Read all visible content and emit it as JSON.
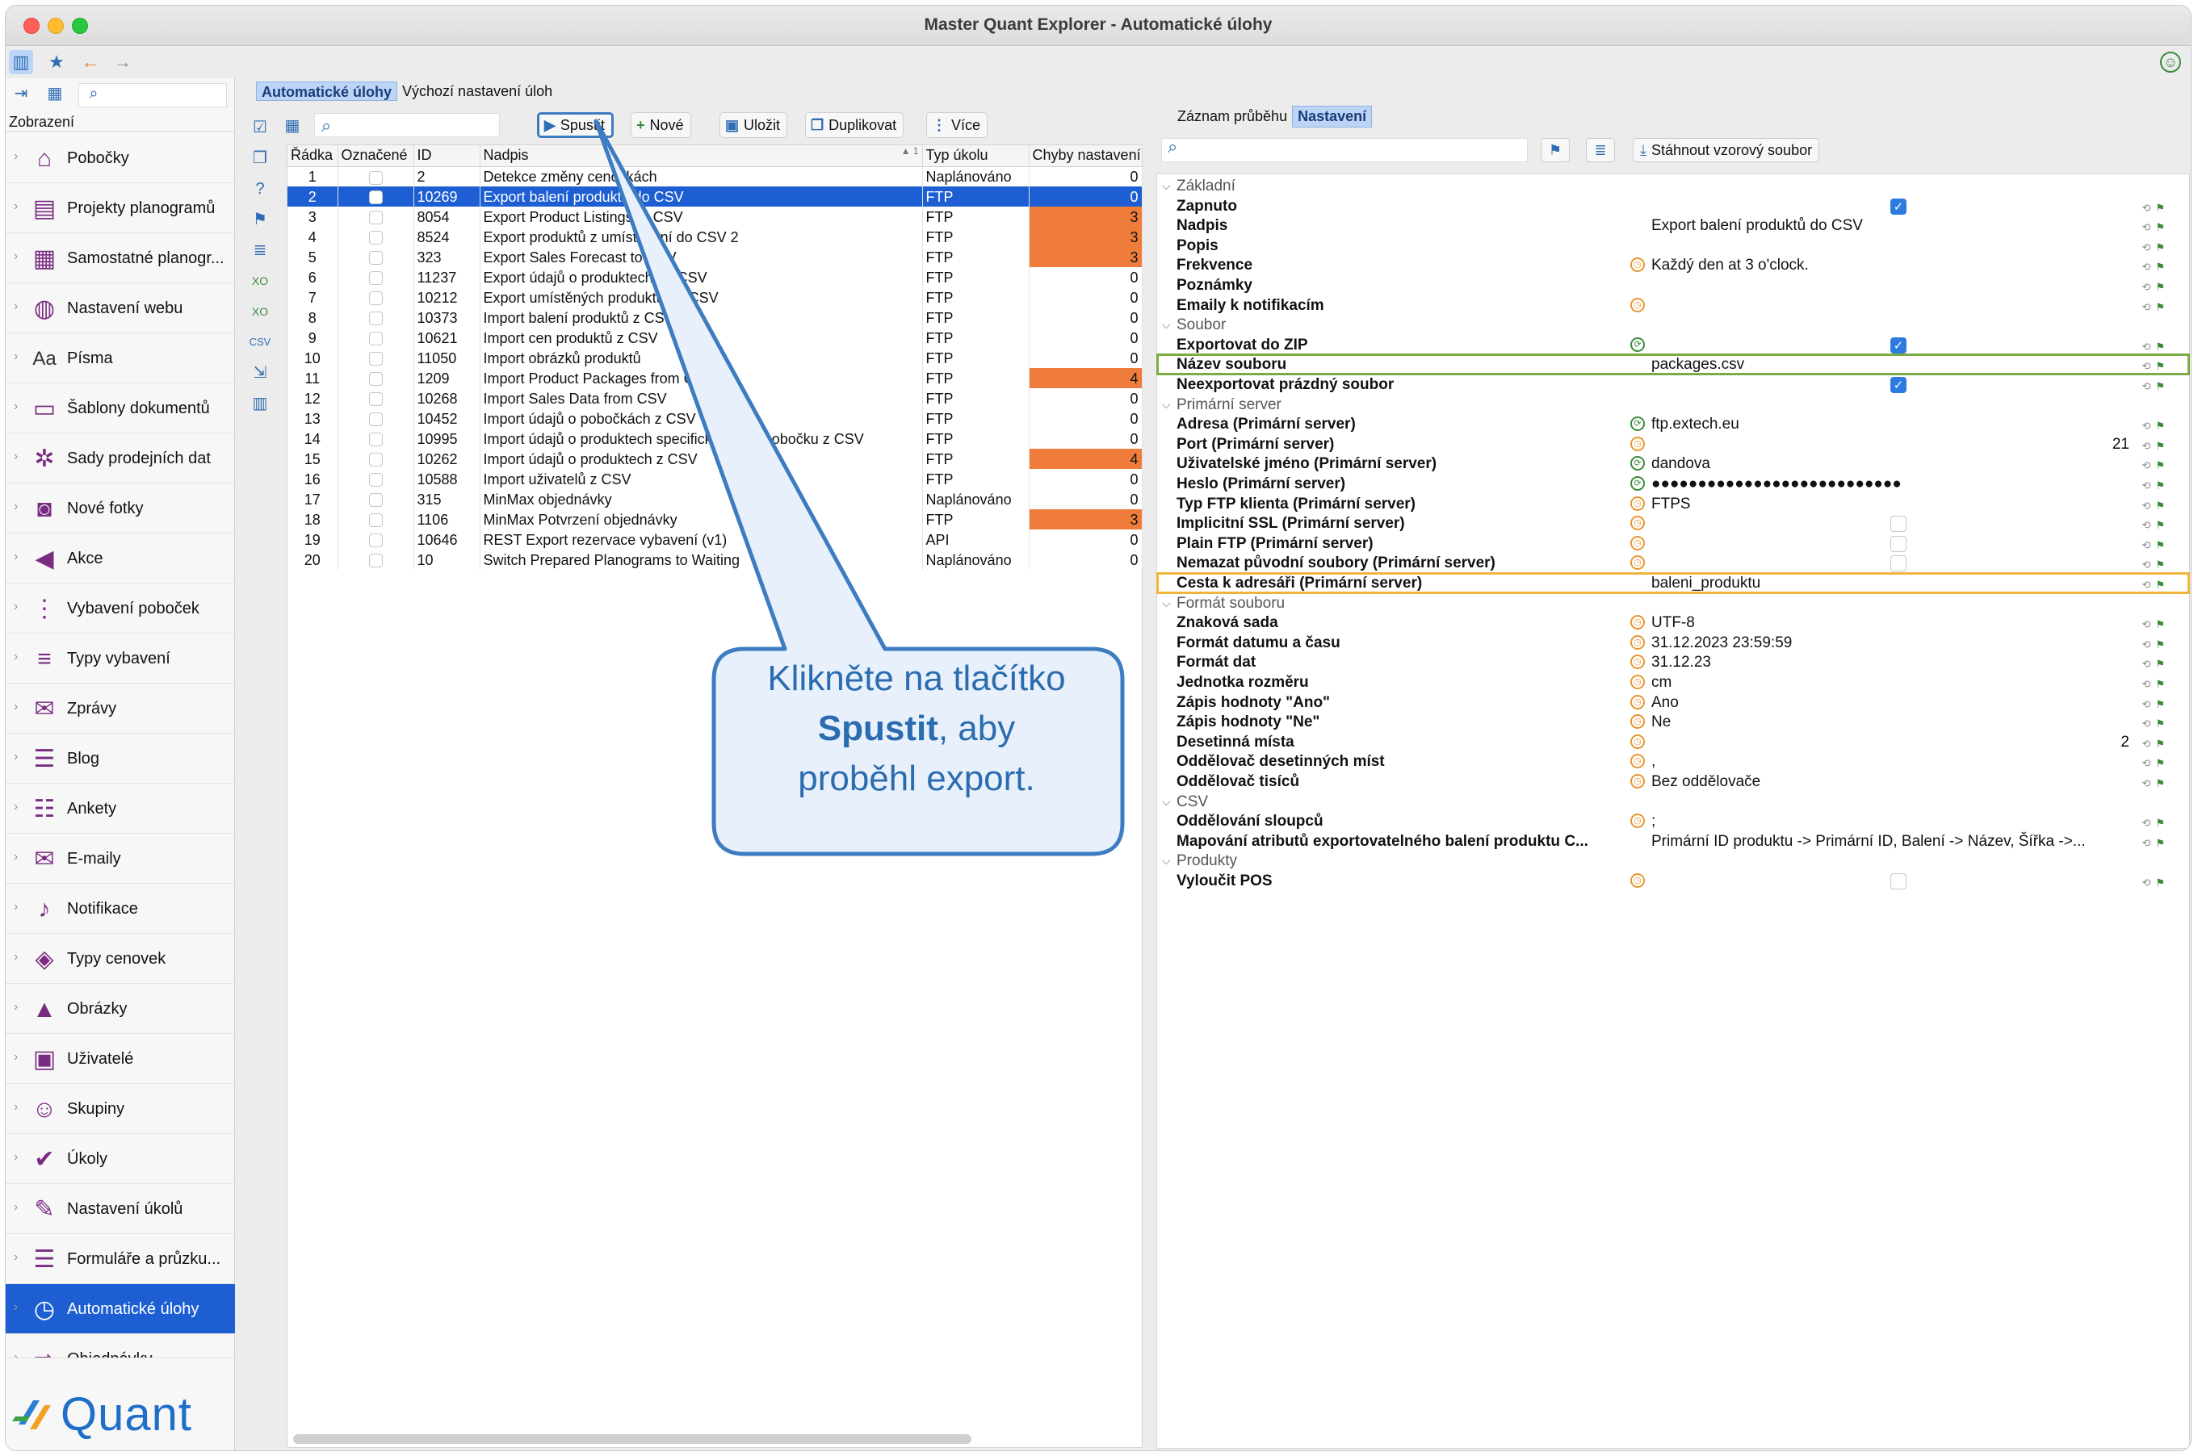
{
  "window": {
    "title": "Master Quant Explorer - Automatické úlohy"
  },
  "sidebar": {
    "header": "Zobrazení",
    "items": [
      {
        "label": "Pobočky",
        "icon": "store-icon"
      },
      {
        "label": "Projekty planogramů",
        "icon": "planogram-projects-icon"
      },
      {
        "label": "Samostatné planogr...",
        "icon": "planogram-icon"
      },
      {
        "label": "Nastavení webu",
        "icon": "globe-icon"
      },
      {
        "label": "Písma",
        "icon": "font-icon"
      },
      {
        "label": "Šablony dokumentů",
        "icon": "document-template-icon"
      },
      {
        "label": "Sady prodejních dat",
        "icon": "sales-data-icon"
      },
      {
        "label": "Nové fotky",
        "icon": "camera-icon"
      },
      {
        "label": "Akce",
        "icon": "megaphone-icon"
      },
      {
        "label": "Vybavení poboček",
        "icon": "equipment-icon"
      },
      {
        "label": "Typy vybavení",
        "icon": "equipment-types-icon"
      },
      {
        "label": "Zprávy",
        "icon": "message-icon"
      },
      {
        "label": "Blog",
        "icon": "blog-icon"
      },
      {
        "label": "Ankety",
        "icon": "survey-icon"
      },
      {
        "label": "E-maily",
        "icon": "email-icon"
      },
      {
        "label": "Notifikace",
        "icon": "bell-icon"
      },
      {
        "label": "Typy cenovek",
        "icon": "price-tag-icon"
      },
      {
        "label": "Obrázky",
        "icon": "image-icon"
      },
      {
        "label": "Uživatelé",
        "icon": "user-icon"
      },
      {
        "label": "Skupiny",
        "icon": "group-icon"
      },
      {
        "label": "Úkoly",
        "icon": "task-icon"
      },
      {
        "label": "Nastavení úkolů",
        "icon": "task-settings-icon"
      },
      {
        "label": "Formuláře a průzku...",
        "icon": "form-icon"
      },
      {
        "label": "Automatické úlohy",
        "icon": "clock-icon"
      },
      {
        "label": "Objednávky",
        "icon": "order-icon"
      }
    ],
    "logo": "Quant"
  },
  "left": {
    "tabs": [
      "Automatické úlohy",
      "Výchozí nastavení úloh"
    ],
    "toolbar": {
      "run": "Spustit",
      "new": "Nové",
      "save": "Uložit",
      "duplicate": "Duplikovat",
      "more": "Více"
    },
    "columns": [
      "Řádka",
      "Označené",
      "ID",
      "Nadpis",
      "Typ úkolu",
      "Chyby nastavení"
    ],
    "sort_indicator": "1",
    "rows": [
      {
        "row": "1",
        "id": "2",
        "title": "Detekce změny cenovkách",
        "type": "Naplánováno",
        "errors": "0",
        "hi": false
      },
      {
        "row": "2",
        "id": "10269",
        "title": "Export balení produktů do CSV",
        "type": "FTP",
        "errors": "0",
        "hi": false
      },
      {
        "row": "3",
        "id": "8054",
        "title": "Export Product Listings to CSV",
        "type": "FTP",
        "errors": "3",
        "hi": true
      },
      {
        "row": "4",
        "id": "8524",
        "title": "Export produktů z umístování do CSV 2",
        "type": "FTP",
        "errors": "3",
        "hi": true
      },
      {
        "row": "5",
        "id": "323",
        "title": "Export Sales Forecast to CSV",
        "type": "FTP",
        "errors": "3",
        "hi": true
      },
      {
        "row": "6",
        "id": "11237",
        "title": "Export údajů o produktech do CSV",
        "type": "FTP",
        "errors": "0",
        "hi": false
      },
      {
        "row": "7",
        "id": "10212",
        "title": "Export umístěných produktů do CSV",
        "type": "FTP",
        "errors": "0",
        "hi": false
      },
      {
        "row": "8",
        "id": "10373",
        "title": "Import balení produktů z CSV 2",
        "type": "FTP",
        "errors": "0",
        "hi": false
      },
      {
        "row": "9",
        "id": "10621",
        "title": "Import cen produktů z CSV",
        "type": "FTP",
        "errors": "0",
        "hi": false
      },
      {
        "row": "10",
        "id": "11050",
        "title": "Import obrázků produktů",
        "type": "FTP",
        "errors": "0",
        "hi": false
      },
      {
        "row": "11",
        "id": "1209",
        "title": "Import Product Packages from CSV",
        "type": "FTP",
        "errors": "4",
        "hi": true
      },
      {
        "row": "12",
        "id": "10268",
        "title": "Import Sales Data from CSV",
        "type": "FTP",
        "errors": "0",
        "hi": false
      },
      {
        "row": "13",
        "id": "10452",
        "title": "Import údajů o pobočkách z CSV",
        "type": "FTP",
        "errors": "0",
        "hi": false
      },
      {
        "row": "14",
        "id": "10995",
        "title": "Import údajů o produktech specifických pro pobočku z CSV",
        "type": "FTP",
        "errors": "0",
        "hi": false
      },
      {
        "row": "15",
        "id": "10262",
        "title": "Import údajů o produktech z CSV",
        "type": "FTP",
        "errors": "4",
        "hi": true
      },
      {
        "row": "16",
        "id": "10588",
        "title": "Import uživatelů z CSV",
        "type": "FTP",
        "errors": "0",
        "hi": false
      },
      {
        "row": "17",
        "id": "315",
        "title": "MinMax objednávky",
        "type": "Naplánováno",
        "errors": "0",
        "hi": false
      },
      {
        "row": "18",
        "id": "1106",
        "title": "MinMax Potvrzení objednávky",
        "type": "FTP",
        "errors": "3",
        "hi": true
      },
      {
        "row": "19",
        "id": "10646",
        "title": "REST Export rezervace vybavení (v1)",
        "type": "API",
        "errors": "0",
        "hi": false
      },
      {
        "row": "20",
        "id": "10",
        "title": "Switch Prepared Planograms to Waiting",
        "type": "Naplánováno",
        "errors": "0",
        "hi": false
      }
    ],
    "selected_row_index": 1
  },
  "right": {
    "tabs": [
      "Záznam průběhu",
      "Nastavení"
    ],
    "download_button": "Stáhnout vzorový soubor",
    "properties": [
      {
        "kind": "group",
        "label": "Základní"
      },
      {
        "kind": "prop",
        "name": "Zapnuto",
        "icon": "",
        "value": "",
        "check": "on"
      },
      {
        "kind": "prop",
        "name": "Nadpis",
        "icon": "",
        "value": "Export balení produktů do CSV"
      },
      {
        "kind": "prop",
        "name": "Popis",
        "icon": "",
        "value": ""
      },
      {
        "kind": "prop",
        "name": "Frekvence",
        "icon": "o",
        "value": "Každý den at 3 o'clock."
      },
      {
        "kind": "prop",
        "name": "Poznámky",
        "icon": "",
        "value": ""
      },
      {
        "kind": "prop",
        "name": "Emaily k notifikacím",
        "icon": "o",
        "value": ""
      },
      {
        "kind": "group",
        "label": "Soubor"
      },
      {
        "kind": "prop",
        "name": "Exportovat do ZIP",
        "icon": "g",
        "value": "",
        "check": "on"
      },
      {
        "kind": "prop",
        "name": "Název souboru",
        "icon": "",
        "value": "packages.csv",
        "box": "green"
      },
      {
        "kind": "prop",
        "name": "Neexportovat prázdný soubor",
        "icon": "",
        "value": "",
        "check": "on"
      },
      {
        "kind": "group",
        "label": "Primární server"
      },
      {
        "kind": "prop",
        "name": "Adresa (Primární server)",
        "icon": "g",
        "value": "ftp.extech.eu"
      },
      {
        "kind": "prop",
        "name": "Port (Primární server)",
        "icon": "o",
        "value": "21",
        "align": "right"
      },
      {
        "kind": "prop",
        "name": "Uživatelské jméno (Primární server)",
        "icon": "g",
        "value": "dandova"
      },
      {
        "kind": "prop",
        "name": "Heslo (Primární server)",
        "icon": "g",
        "value": "●●●●●●●●●●●●●●●●●●●●●●●●●●●"
      },
      {
        "kind": "prop",
        "name": "Typ FTP klienta (Primární server)",
        "icon": "o",
        "value": "FTPS"
      },
      {
        "kind": "prop",
        "name": "Implicitní SSL (Primární server)",
        "icon": "o",
        "value": "",
        "check": "off"
      },
      {
        "kind": "prop",
        "name": "Plain FTP (Primární server)",
        "icon": "o",
        "value": "",
        "check": "off"
      },
      {
        "kind": "prop",
        "name": "Nemazat původní soubory (Primární server)",
        "icon": "o",
        "value": "",
        "check": "off"
      },
      {
        "kind": "prop",
        "name": "Cesta k adresáři (Primární server)",
        "icon": "",
        "value": "baleni_produktu",
        "box": "orange"
      },
      {
        "kind": "group",
        "label": "Formát souboru"
      },
      {
        "kind": "prop",
        "name": "Znaková sada",
        "icon": "o",
        "value": "UTF-8"
      },
      {
        "kind": "prop",
        "name": "Formát datumu a času",
        "icon": "o",
        "value": "31.12.2023 23:59:59"
      },
      {
        "kind": "prop",
        "name": "Formát dat",
        "icon": "o",
        "value": "31.12.23"
      },
      {
        "kind": "prop",
        "name": "Jednotka rozměru",
        "icon": "o",
        "value": "cm"
      },
      {
        "kind": "prop",
        "name": "Zápis hodnoty \"Ano\"",
        "icon": "o",
        "value": "Ano"
      },
      {
        "kind": "prop",
        "name": "Zápis hodnoty \"Ne\"",
        "icon": "o",
        "value": "Ne"
      },
      {
        "kind": "prop",
        "name": "Desetinná místa",
        "icon": "o",
        "value": "2",
        "align": "right"
      },
      {
        "kind": "prop",
        "name": "Oddělovač desetinných míst",
        "icon": "o",
        "value": ","
      },
      {
        "kind": "prop",
        "name": "Oddělovač tisíců",
        "icon": "o",
        "value": "Bez oddělovače"
      },
      {
        "kind": "group",
        "label": "CSV"
      },
      {
        "kind": "prop",
        "name": "Oddělování sloupců",
        "icon": "o",
        "value": ";"
      },
      {
        "kind": "prop",
        "name": "Mapování atributů exportovatelného balení produktu C...",
        "icon": "",
        "value": "Primární ID produktu -> Primární ID, Balení -> Název, Šířka ->..."
      },
      {
        "kind": "group",
        "label": "Produkty"
      },
      {
        "kind": "prop",
        "name": "Vyloučit POS",
        "icon": "o",
        "value": "",
        "check": "off"
      }
    ]
  },
  "callout": {
    "line1": "Klikněte na tlačítko",
    "bold": "Spustit",
    "after_bold": ", aby",
    "line3": "proběhl export."
  },
  "colors": {
    "selection": "#1d5fd3",
    "error_highlight": "#ef7c3a",
    "callout_border": "#3e7cc1",
    "callout_fill": "#e8f1fb",
    "green_box": "#7aab45",
    "orange_box": "#f0b43b"
  }
}
